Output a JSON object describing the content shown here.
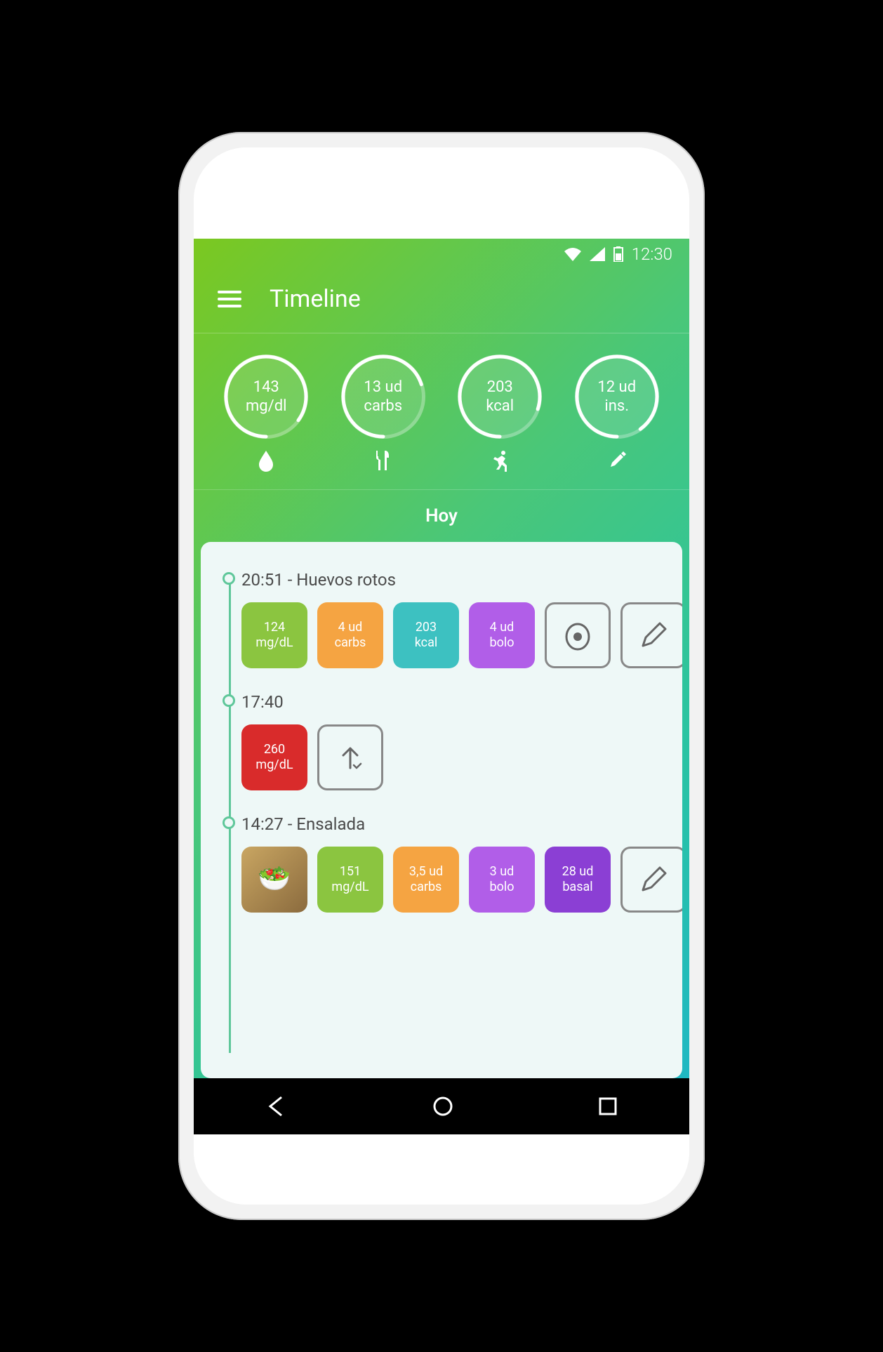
{
  "statusbar": {
    "time": "12:30"
  },
  "appbar": {
    "title": "Timeline"
  },
  "stats": [
    {
      "value": "143",
      "unit": "mg/dl",
      "icon": "drop",
      "progress": 0.85
    },
    {
      "value": "13 ud",
      "unit": "carbs",
      "icon": "fork-knife",
      "progress": 0.7
    },
    {
      "value": "203",
      "unit": "kcal",
      "icon": "runner",
      "progress": 0.8
    },
    {
      "value": "12 ud",
      "unit": "ins.",
      "icon": "syringe",
      "progress": 0.9
    }
  ],
  "dateHeader": "Hoy",
  "entries": [
    {
      "title": "20:51 - Huevos rotos",
      "chips": [
        {
          "kind": "val",
          "color": "green",
          "value": "124",
          "unit": "mg/dL"
        },
        {
          "kind": "val",
          "color": "orange",
          "value": "4 ud",
          "unit": "carbs"
        },
        {
          "kind": "val",
          "color": "teal",
          "value": "203",
          "unit": "kcal"
        },
        {
          "kind": "val",
          "color": "purple",
          "value": "4 ud",
          "unit": "bolo"
        },
        {
          "kind": "icon",
          "color": "outline",
          "icon": "egg"
        },
        {
          "kind": "icon",
          "color": "outline",
          "icon": "edit"
        }
      ]
    },
    {
      "title": "17:40",
      "chips": [
        {
          "kind": "val",
          "color": "red",
          "value": "260",
          "unit": "mg/dL"
        },
        {
          "kind": "icon",
          "color": "outline",
          "icon": "arrow-up-check"
        }
      ]
    },
    {
      "title": "14:27 - Ensalada",
      "chips": [
        {
          "kind": "photo"
        },
        {
          "kind": "val",
          "color": "green",
          "value": "151",
          "unit": "mg/dL"
        },
        {
          "kind": "val",
          "color": "orange",
          "value": "3,5 ud",
          "unit": "carbs"
        },
        {
          "kind": "val",
          "color": "purple",
          "value": "3 ud",
          "unit": "bolo"
        },
        {
          "kind": "val",
          "color": "violet",
          "value": "28 ud",
          "unit": "basal"
        },
        {
          "kind": "icon",
          "color": "outline",
          "icon": "edit"
        }
      ]
    }
  ]
}
